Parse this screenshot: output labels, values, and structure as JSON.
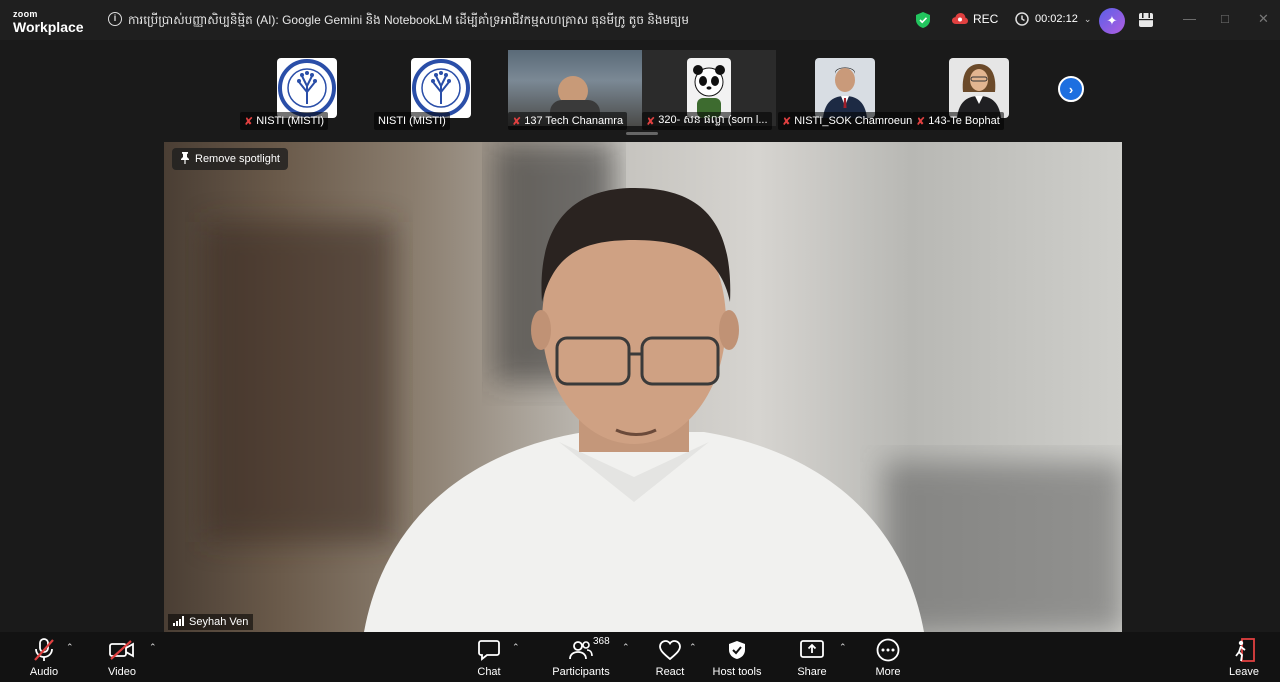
{
  "app": {
    "logo_line1": "zoom",
    "logo_line2": "Workplace"
  },
  "title_bar": {
    "meeting_title": "ការប្រើប្រាស់បញ្ញាសិប្បនិម្មិត (AI): Google Gemini និង NotebookLM ដើម្បីគាំទ្រអាជីវកម្មសហគ្រាស ធុនមីក្រូ តូច និងមធ្យម",
    "rec_label": "REC",
    "timer": "00:02:12"
  },
  "participant_strip": {
    "tiles": [
      {
        "name": "NISTI (MISTI)",
        "muted": true
      },
      {
        "name": "NISTI (MISTI)",
        "muted": false
      },
      {
        "name": "137 Tech Chanamra",
        "muted": true
      },
      {
        "name": "320- សន ផល្លា (sorn l...",
        "muted": true
      },
      {
        "name": "NISTI_SOK Chamroeun",
        "muted": true
      },
      {
        "name": "143-Te Bophat",
        "muted": true
      }
    ]
  },
  "spotlight": {
    "remove_label": "Remove spotlight",
    "speaker_name": "Seyhah Ven"
  },
  "toolbar": {
    "audio": "Audio",
    "video": "Video",
    "chat": "Chat",
    "participants": "Participants",
    "participant_count": "368",
    "react": "React",
    "host_tools": "Host tools",
    "share": "Share",
    "more": "More",
    "leave": "Leave"
  },
  "colors": {
    "accent": "#1d6fe0",
    "muted_red": "#e04040",
    "secure_green": "#22c55e"
  }
}
